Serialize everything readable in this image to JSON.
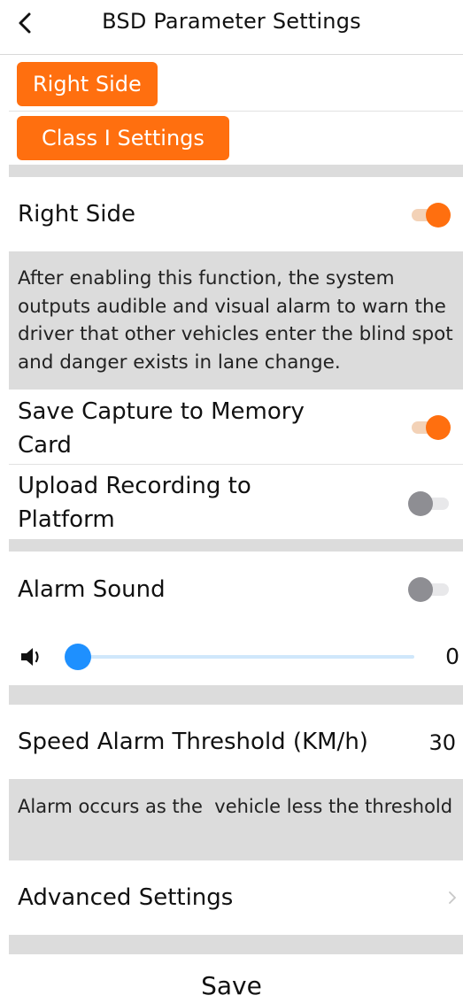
{
  "header": {
    "title": "BSD Parameter Settings",
    "back_icon": "chevron-left-icon"
  },
  "tabs": {
    "side_label": "Right Side",
    "class_label": "Class I Settings"
  },
  "accent_color": "#ff6f0f",
  "right_side": {
    "label": "Right Side",
    "enabled": true,
    "description": "After enabling this function, the system outputs audible and visual alarm to warn the driver that other vehicles enter the blind spot and danger exists in lane change."
  },
  "save_capture": {
    "label": "Save Capture to Memory Card",
    "enabled": true
  },
  "upload_recording": {
    "label": "Upload Recording to Platform",
    "enabled": false
  },
  "alarm_sound": {
    "label": "Alarm Sound",
    "enabled": false,
    "volume": 0,
    "volume_icon": "speaker-icon"
  },
  "speed_threshold": {
    "label": "Speed Alarm Threshold (KM/h)",
    "value": "30",
    "description": "Alarm occurs as the  vehicle less the threshold"
  },
  "advanced": {
    "label": "Advanced Settings",
    "icon": "chevron-right-icon"
  },
  "footer": {
    "save_label": "Save"
  }
}
